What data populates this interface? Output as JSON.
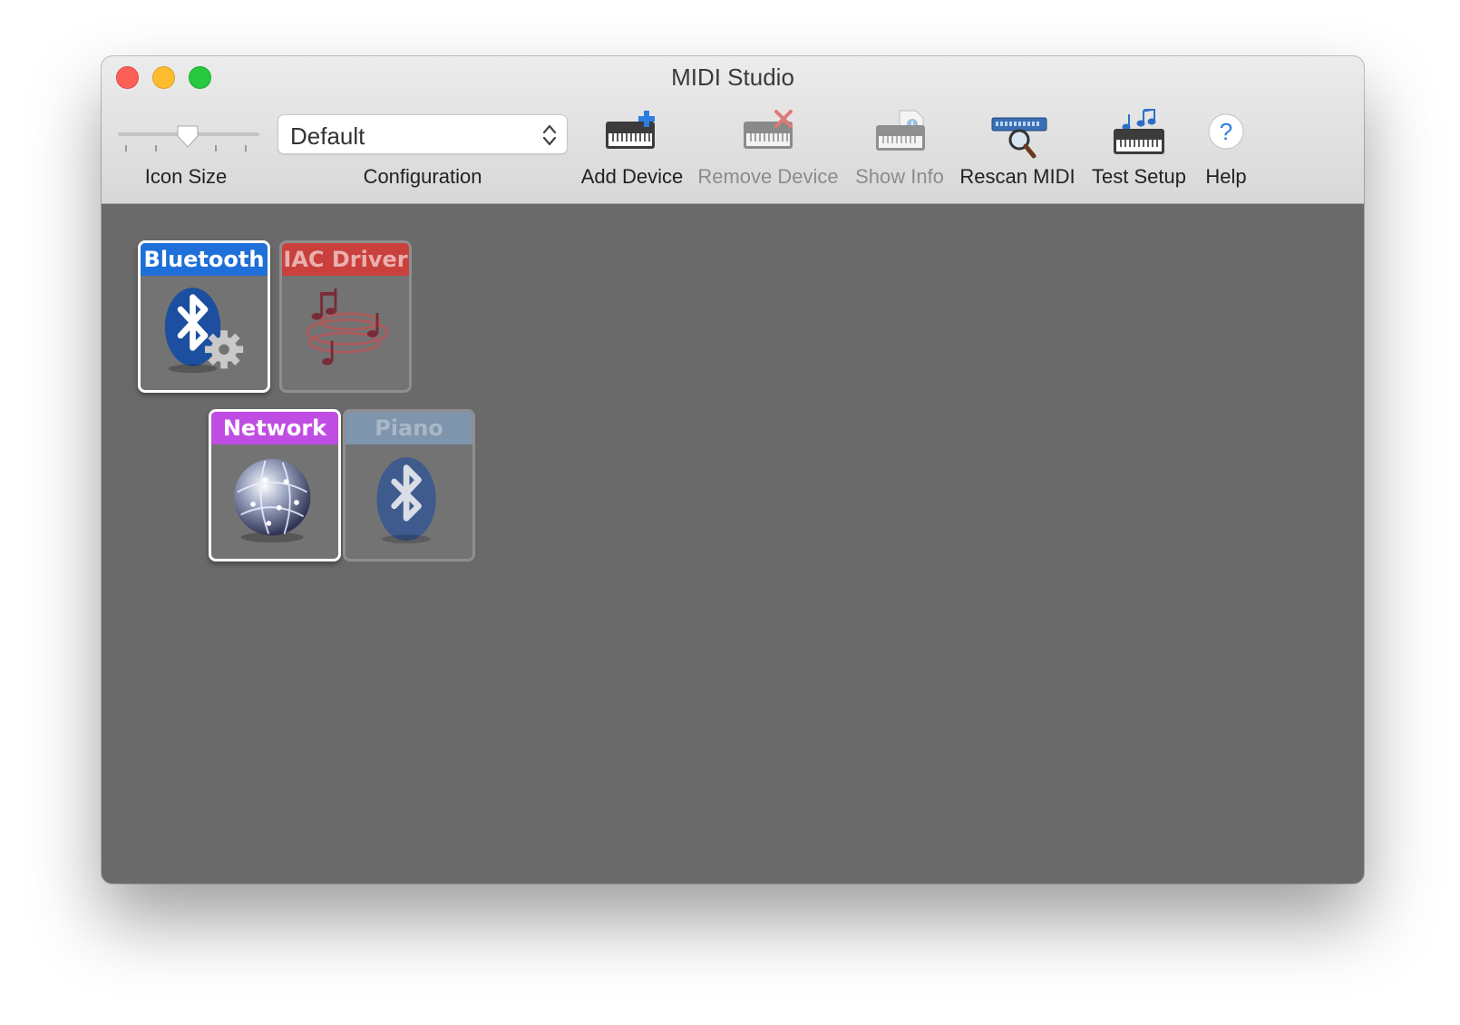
{
  "window": {
    "title": "MIDI Studio"
  },
  "toolbar": {
    "icon_size_label": "Icon Size",
    "configuration_label": "Configuration",
    "configuration_value": "Default",
    "add_device": "Add Device",
    "remove_device": "Remove Device",
    "show_info": "Show Info",
    "rescan_midi": "Rescan MIDI",
    "test_setup": "Test Setup",
    "help": "Help"
  },
  "devices": [
    {
      "name": "Bluetooth",
      "color": "#1f6fd8",
      "active": true,
      "icon": "bluetooth-settings-icon"
    },
    {
      "name": "IAC Driver",
      "color": "#c9403c",
      "active": false,
      "icon": "midi-notes-icon"
    },
    {
      "name": "Network",
      "color": "#c04de3",
      "active": true,
      "icon": "network-globe-icon"
    },
    {
      "name": "Piano",
      "color": "#7f94ad",
      "active": false,
      "icon": "bluetooth-icon"
    }
  ]
}
